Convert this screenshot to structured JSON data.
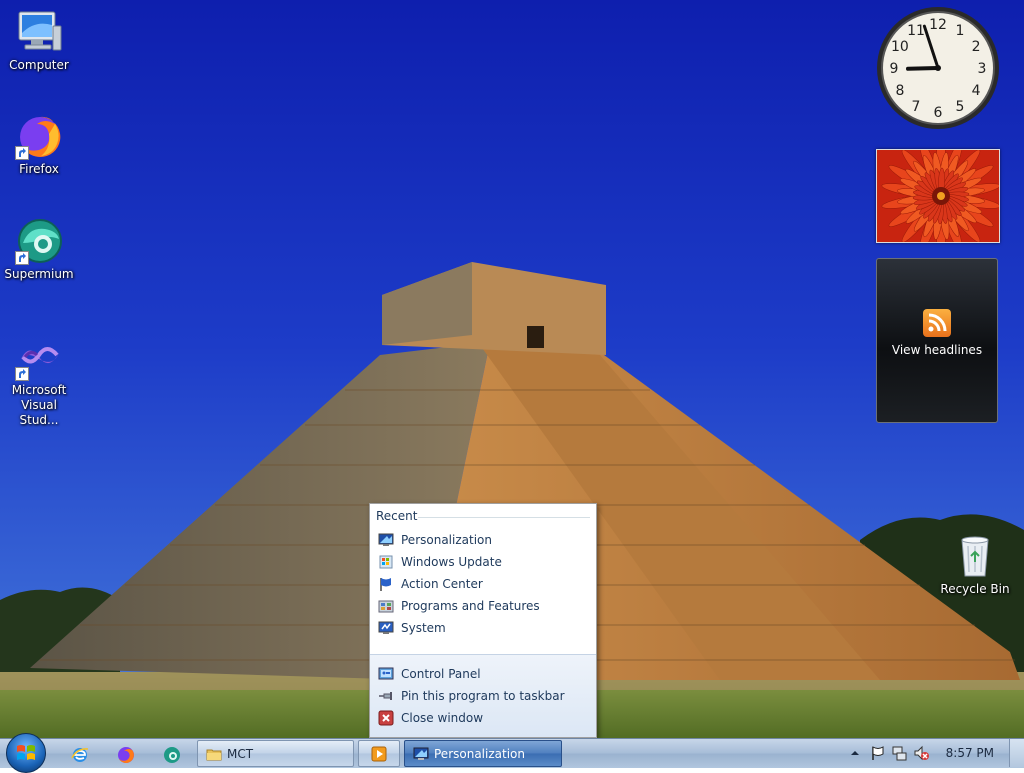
{
  "desktop": {
    "icons": [
      {
        "label": "Computer",
        "icon": "computer-icon"
      },
      {
        "label": "Firefox",
        "icon": "firefox-icon"
      },
      {
        "label": "Supermium",
        "icon": "supermium-icon"
      },
      {
        "label": "Microsoft Visual Stud...",
        "icon": "visual-studio-icon"
      },
      {
        "label": "Recycle Bin",
        "icon": "recycle-bin-icon"
      }
    ]
  },
  "gadgets": {
    "clock": {
      "hour": 8,
      "minute": 57
    },
    "feed": {
      "label": "View headlines",
      "icon": "rss-icon"
    }
  },
  "jumplist": {
    "recent_heading": "Recent",
    "recent": [
      {
        "label": "Personalization",
        "icon": "personalization-icon"
      },
      {
        "label": "Windows Update",
        "icon": "windows-update-icon"
      },
      {
        "label": "Action Center",
        "icon": "action-center-flag-icon"
      },
      {
        "label": "Programs and Features",
        "icon": "programs-features-icon"
      },
      {
        "label": "System",
        "icon": "system-icon"
      }
    ],
    "tasks": [
      {
        "label": "Control Panel",
        "icon": "control-panel-icon"
      },
      {
        "label": "Pin this program to taskbar",
        "icon": "pin-icon"
      },
      {
        "label": "Close window",
        "icon": "close-window-icon"
      }
    ]
  },
  "taskbar": {
    "pinned": [
      "internet-explorer-icon",
      "firefox-icon",
      "supermium-icon"
    ],
    "tasks": [
      {
        "label": "MCT",
        "icon": "folder-icon"
      },
      {
        "label": "",
        "icon": "media-player-icon"
      },
      {
        "label": "Personalization",
        "icon": "personalization-icon",
        "active": true
      }
    ],
    "tray": {
      "icons": [
        "show-hidden-icons-arrow",
        "action-center-flag-icon",
        "network-icon",
        "volume-muted-icon"
      ],
      "time": "8:57 PM"
    }
  },
  "colors": {
    "sky": "#1530b8",
    "taskbar": "#b1c6de",
    "jumplist_text": "#1e395b"
  }
}
